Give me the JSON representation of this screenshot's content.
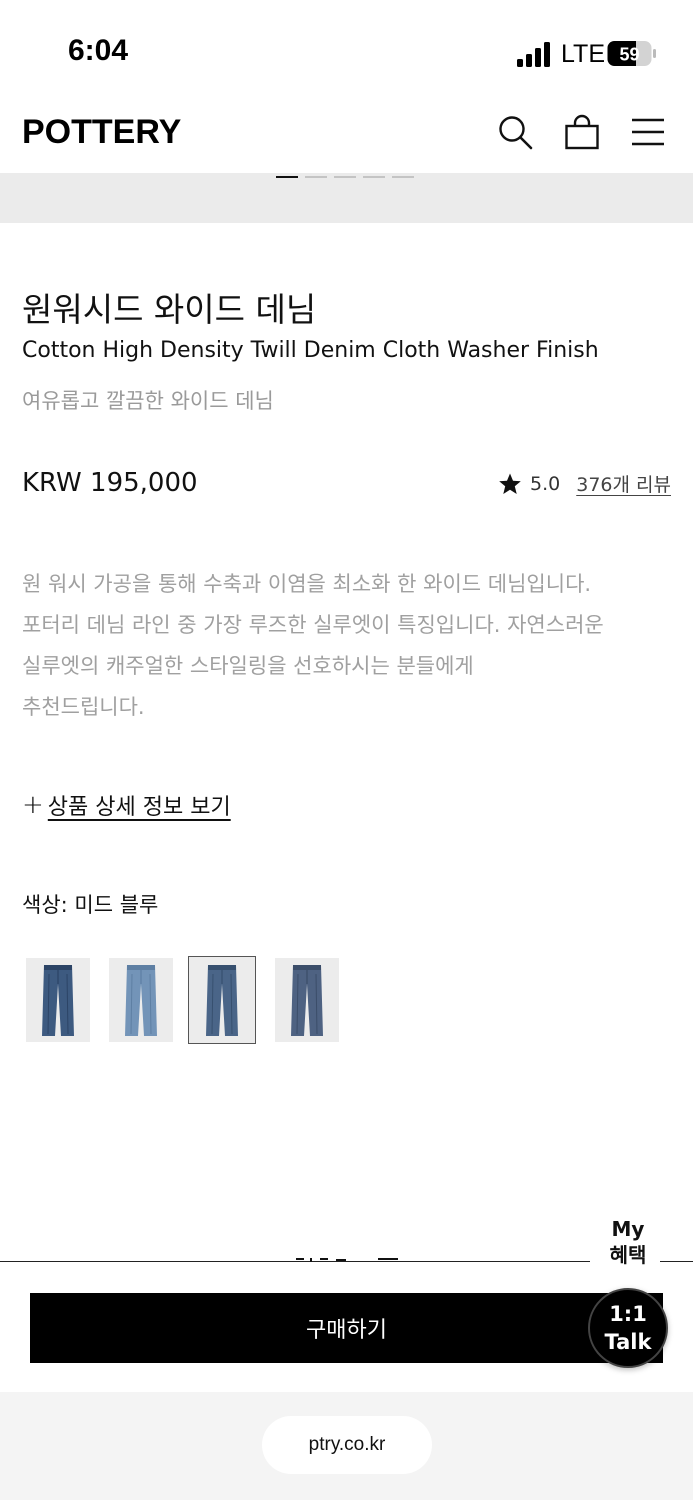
{
  "status_bar": {
    "time": "6:04",
    "network": "LTE",
    "battery": "59"
  },
  "header": {
    "logo": "POTTERY",
    "icons": [
      "search-icon",
      "shopping-bag-icon",
      "menu-icon"
    ]
  },
  "gallery": {
    "dot_count": 5,
    "active_index": 0
  },
  "product": {
    "title_ko": "원워시드 와이드 데님",
    "title_en": "Cotton High Density Twill Denim Cloth Washer Finish",
    "subtitle": "여유롭고 깔끔한 와이드 데님",
    "price": "KRW 195,000",
    "rating": "5.0",
    "review_link": "376개 리뷰",
    "description": [
      "원 워시 가공을 통해 수축과 이염을 최소화 한 와이드 데님입니다.",
      "포터리 데님 라인 중 가장 루즈한 실루엣이 특징입니다. 자연스러운",
      "실루엣의 캐주얼한 스타일링을 선호하시는 분들에게",
      "추천드립니다."
    ],
    "detail_plus": "+",
    "detail_link": "상품 상세 정보 보기",
    "color_label": "색상: 미드 블루",
    "swatches": [
      {
        "color": "#3d5a80",
        "shade": "#2c4466"
      },
      {
        "color": "#7394b8",
        "shade": "#5e7fa3"
      },
      {
        "color": "#4a6588",
        "shade": "#37506f"
      },
      {
        "color": "#4e6282",
        "shade": "#3b4d69"
      }
    ],
    "selected_swatch": 2
  },
  "bottom": {
    "my_benefit_line1": "My",
    "my_benefit_line2": "혜택",
    "buy_label": "구매하기",
    "talk_line1": "1:1",
    "talk_line2": "Talk"
  },
  "browser": {
    "url": "ptry.co.kr"
  }
}
